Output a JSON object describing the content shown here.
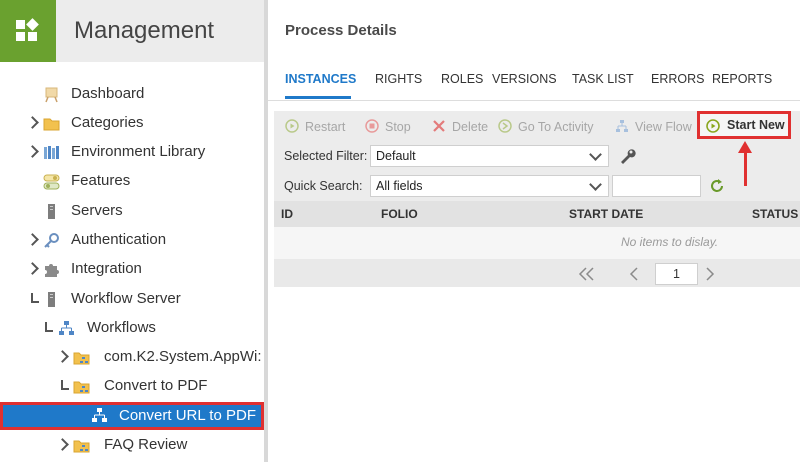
{
  "app": {
    "title": "Management"
  },
  "sidebar": {
    "items": [
      {
        "label": "Dashboard",
        "icon": "easel-icon"
      },
      {
        "label": "Categories",
        "icon": "folder-icon"
      },
      {
        "label": "Environment Library",
        "icon": "library-icon"
      },
      {
        "label": "Features",
        "icon": "toggle-icon"
      },
      {
        "label": "Servers",
        "icon": "server-icon"
      },
      {
        "label": "Authentication",
        "icon": "key-icon"
      },
      {
        "label": "Integration",
        "icon": "puzzle-icon"
      },
      {
        "label": "Workflow Server",
        "icon": "server-icon"
      },
      {
        "label": "Workflows",
        "icon": "workflow-icon"
      },
      {
        "label": "com.K2.System.AppWi:",
        "icon": "folder-workflow-icon"
      },
      {
        "label": "Convert to PDF",
        "icon": "folder-workflow-icon"
      },
      {
        "label": "Convert URL to PDF",
        "icon": "workflow-icon",
        "selected": true
      },
      {
        "label": "FAQ Review",
        "icon": "folder-workflow-icon"
      }
    ]
  },
  "main": {
    "title": "Process Details",
    "tabs": [
      {
        "label": "INSTANCES",
        "active": true
      },
      {
        "label": "RIGHTS"
      },
      {
        "label": "ROLES"
      },
      {
        "label": "VERSIONS"
      },
      {
        "label": "TASK LIST"
      },
      {
        "label": "ERRORS"
      },
      {
        "label": "REPORTS"
      }
    ],
    "toolbar": {
      "restart": "Restart",
      "stop": "Stop",
      "delete": "Delete",
      "go_to_activity": "Go To Activity",
      "view_flow": "View Flow",
      "start_new": "Start New"
    },
    "filter": {
      "selected_filter_label": "Selected Filter:",
      "selected_filter_value": "Default",
      "quick_search_label": "Quick Search:",
      "quick_search_value": "All fields",
      "quick_search_text": ""
    },
    "grid": {
      "columns": [
        "ID",
        "FOLIO",
        "START DATE",
        "STATUS"
      ],
      "empty_message": "No items to dislay."
    },
    "pager": {
      "page": "1"
    }
  },
  "colors": {
    "brand_green": "#6aa12f",
    "accent_blue": "#1f79c9",
    "highlight_red": "#e03030",
    "start_green": "#8aa61f"
  }
}
